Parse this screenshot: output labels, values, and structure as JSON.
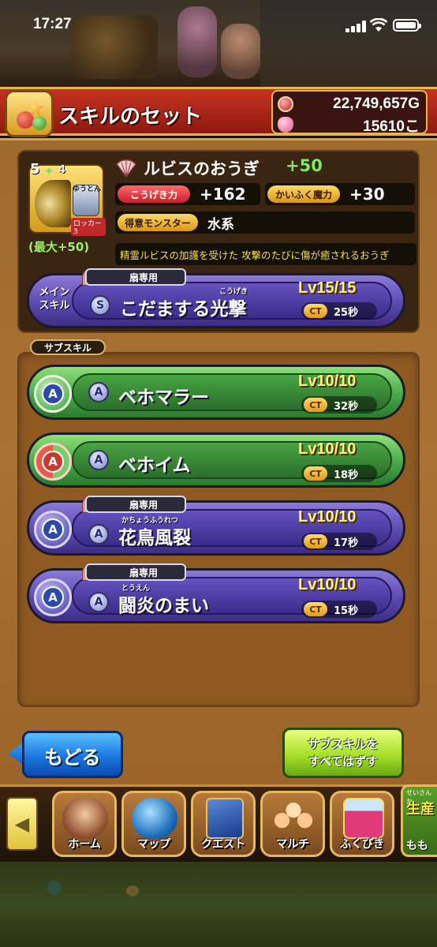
{
  "status_bar": {
    "time": "17:27"
  },
  "header": {
    "title": "スキルのセット",
    "gold": "22,749,657G",
    "gems": "15610こ"
  },
  "weapon": {
    "name": "ルビスのおうぎ",
    "plus": "+50",
    "max_bonus": "(最大+50)",
    "star_level": "5",
    "star_plus": "4",
    "character_name": "ゆうとん",
    "character_role": "ロッカー3",
    "stats": {
      "attack_label": "こうげき力",
      "attack_value": "+162",
      "heal_label": "かいふく魔力",
      "heal_value": "+30",
      "monster_label": "得意モンスター",
      "monster_value": "水系"
    },
    "description": "精霊ルビスの加護を受けた 攻撃のたびに傷が癒されるおうぎ"
  },
  "main_skill": {
    "section_label": "メイン\nスキル",
    "tag": "扇専用",
    "slot_letter": "S",
    "name": "こだまする光撃",
    "ruby": "こうげき",
    "level": "Lv15/15",
    "ct_label": "CT",
    "ct_value": "25秒"
  },
  "sub_skill_label": "サブスキル",
  "sub_skills": [
    {
      "slot": "A",
      "badge": "A",
      "name": "ベホマラー",
      "ruby": "",
      "tag": "",
      "level": "Lv10/10",
      "ct_label": "CT",
      "ct_value": "32秒",
      "color": "green"
    },
    {
      "slot": "A",
      "badge": "A",
      "name": "ベホイム",
      "ruby": "",
      "tag": "",
      "level": "Lv10/10",
      "ct_label": "CT",
      "ct_value": "18秒",
      "color": "green-red"
    },
    {
      "slot": "A",
      "badge": "A",
      "name": "花鳥風裂",
      "ruby": "かちょうふうれつ",
      "tag": "扇専用",
      "level": "Lv10/10",
      "ct_label": "CT",
      "ct_value": "17秒",
      "color": "purple"
    },
    {
      "slot": "A",
      "badge": "A",
      "name": "闘炎のまい",
      "ruby": "とうえん",
      "tag": "扇専用",
      "level": "Lv10/10",
      "ct_label": "CT",
      "ct_value": "15秒",
      "color": "purple"
    }
  ],
  "buttons": {
    "back": "もどる",
    "remove_line1": "サブスキルを",
    "remove_line2": "すべてはずす"
  },
  "nav": {
    "items": [
      {
        "label": "ホーム",
        "icon": "home-icon"
      },
      {
        "label": "マップ",
        "icon": "map-icon"
      },
      {
        "label": "クエスト",
        "icon": "quest-icon"
      },
      {
        "label": "マルチ",
        "icon": "multi-icon"
      },
      {
        "label": "ふくびき",
        "icon": "lottery-icon"
      }
    ],
    "partial_top": "せいさんか",
    "partial_title": "生産",
    "partial_bottom": "もも"
  },
  "colors": {
    "header_red": "#c63222",
    "gold_border": "#e9b450",
    "skill_purple": "#5c4ab0",
    "skill_green": "#4aa84a",
    "level_yellow": "#fff37a",
    "plus_green": "#7ee86a",
    "desc_yellow": "#f8df5a"
  }
}
